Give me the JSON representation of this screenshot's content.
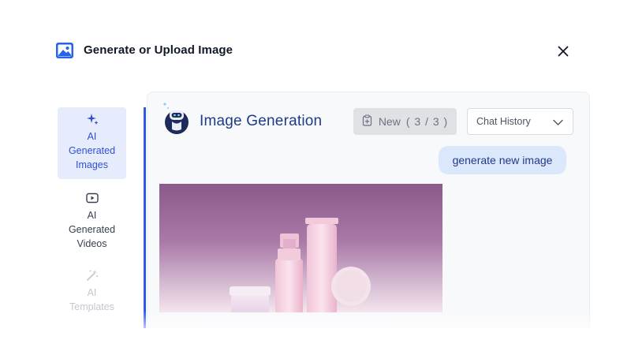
{
  "header": {
    "title": "Generate or Upload Image"
  },
  "sidebar": {
    "items": [
      {
        "label": "AI Generated Images",
        "icon": "sparkles-icon",
        "state": "active"
      },
      {
        "label": "AI Generated Videos",
        "icon": "play-video-icon",
        "state": "normal"
      },
      {
        "label": "AI Templates",
        "icon": "magic-wand-icon",
        "state": "disabled"
      }
    ]
  },
  "panel": {
    "title": "Image Generation",
    "new_button": {
      "label": "New",
      "count": "( 3 / 3 )"
    },
    "chat_history": {
      "label": "Chat History"
    },
    "chat_message": "generate new image"
  },
  "colors": {
    "accent": "#2f5bea",
    "title_blue": "#1e3a8a",
    "bubble": "#dbe8fb",
    "active_bg": "#e6ecfb"
  }
}
